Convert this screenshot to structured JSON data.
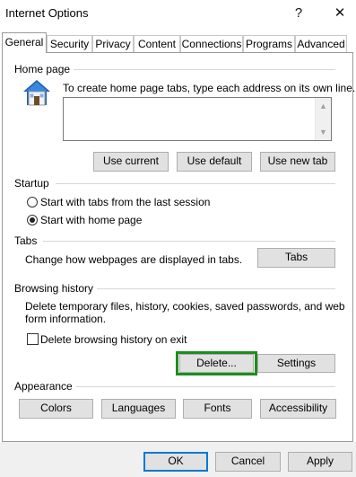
{
  "window": {
    "title": "Internet Options",
    "help_glyph": "?",
    "close_glyph": "✕"
  },
  "tabs": [
    {
      "label": "General",
      "active": true
    },
    {
      "label": "Security"
    },
    {
      "label": "Privacy"
    },
    {
      "label": "Content"
    },
    {
      "label": "Connections"
    },
    {
      "label": "Programs"
    },
    {
      "label": "Advanced"
    }
  ],
  "home_page": {
    "group_label": "Home page",
    "instruction": "To create home page tabs, type each address on its own line.",
    "address_value": "",
    "buttons": {
      "use_current": "Use current",
      "use_default": "Use default",
      "use_new_tab": "Use new tab"
    }
  },
  "startup": {
    "group_label": "Startup",
    "options": [
      {
        "label": "Start with tabs from the last session",
        "selected": false
      },
      {
        "label": "Start with home page",
        "selected": true
      }
    ]
  },
  "tabs_section": {
    "group_label": "Tabs",
    "description": "Change how webpages are displayed in tabs.",
    "button": "Tabs"
  },
  "browsing_history": {
    "group_label": "Browsing history",
    "description_line1": "Delete temporary files, history, cookies, saved passwords, and web",
    "description_line2": "form information.",
    "delete_on_exit_label": "Delete browsing history on exit",
    "delete_on_exit_checked": false,
    "delete_button": "Delete...",
    "settings_button": "Settings",
    "highlight_color": "#1d8d1d"
  },
  "appearance": {
    "group_label": "Appearance",
    "buttons": {
      "colors": "Colors",
      "languages": "Languages",
      "fonts": "Fonts",
      "accessibility": "Accessibility"
    }
  },
  "footer": {
    "ok": "OK",
    "cancel": "Cancel",
    "apply": "Apply"
  },
  "colors": {
    "accent_blue": "#0078d7",
    "button_face": "#e1e1e1",
    "footer_bg": "#f0f0f0"
  }
}
